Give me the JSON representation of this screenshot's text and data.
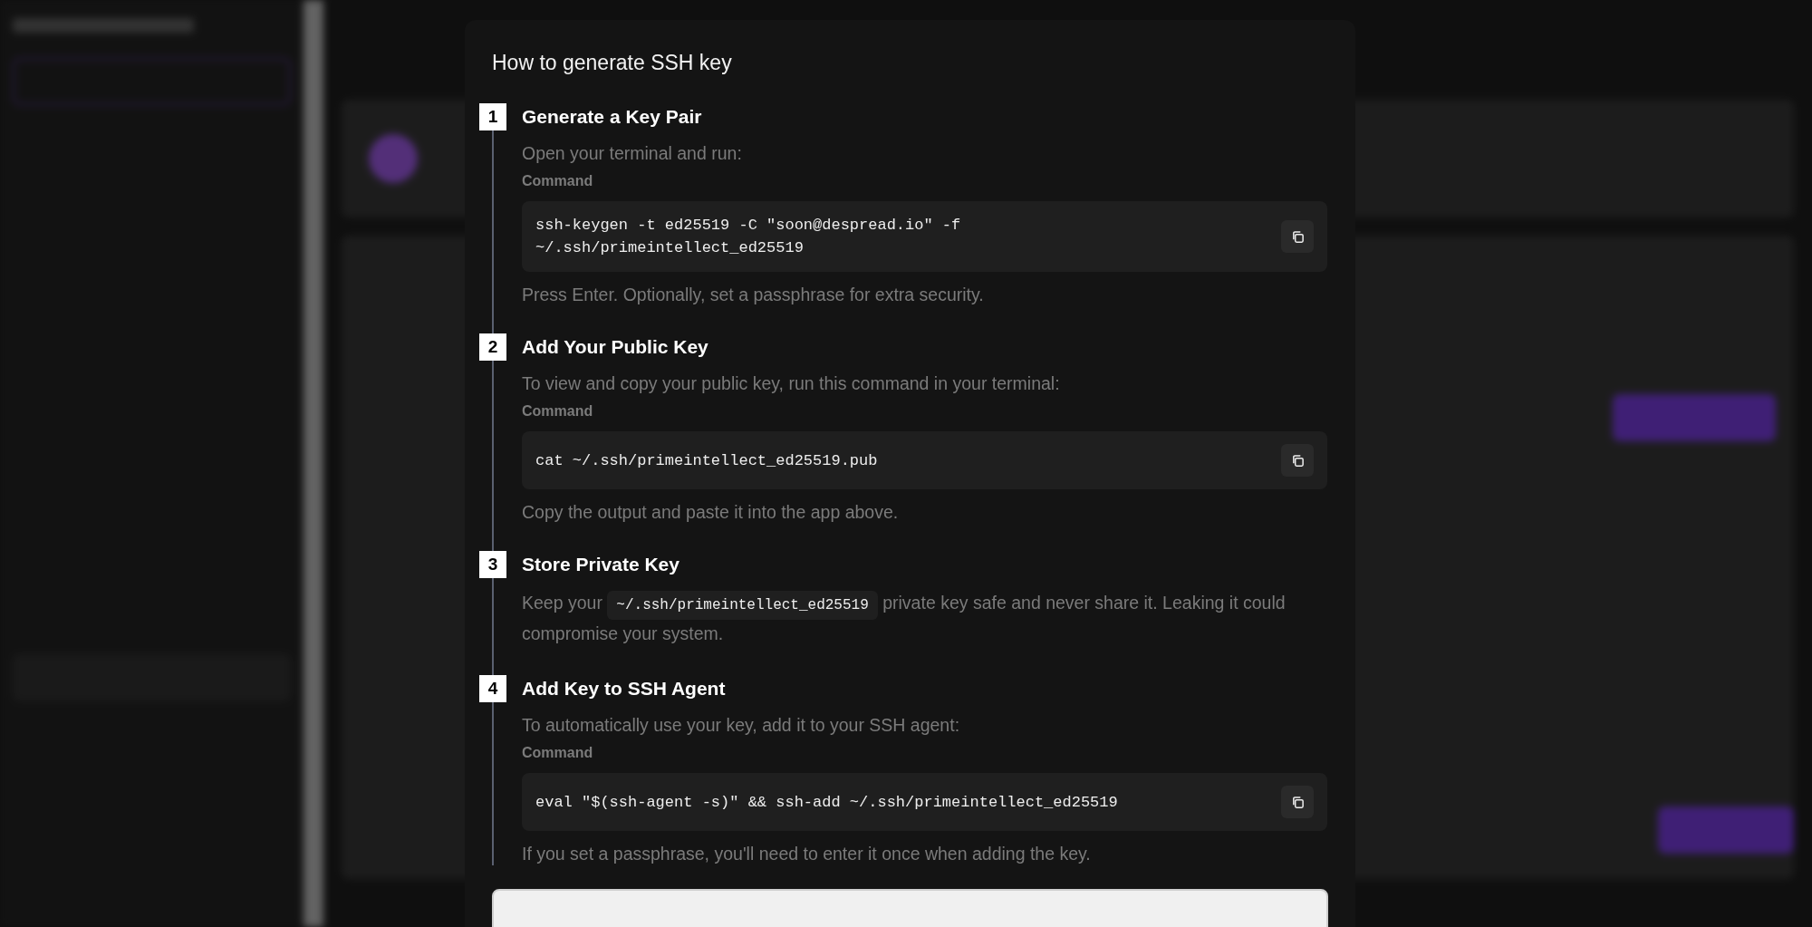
{
  "dialog": {
    "title": "How to generate SSH key",
    "steps": [
      {
        "number": "1",
        "heading": "Generate a Key Pair",
        "intro": "Open your terminal and run:",
        "command_label": "Command",
        "command": [
          "ssh-keygen -t ed25519 -C \"soon@despread.io\" -f",
          "~/.ssh/primeintellect_ed25519"
        ],
        "note": "Press Enter. Optionally, set a passphrase for extra security."
      },
      {
        "number": "2",
        "heading": "Add Your Public Key",
        "intro": "To view and copy your public key, run this command in your terminal:",
        "command_label": "Command",
        "command": [
          "cat ~/.ssh/primeintellect_ed25519.pub"
        ],
        "note": "Copy the output and paste it into the app above."
      },
      {
        "number": "3",
        "heading": "Store Private Key",
        "body": [
          {
            "kind": "text",
            "text": "Keep your"
          },
          {
            "kind": "code",
            "text": "~/.ssh/primeintellect_ed25519"
          },
          {
            "kind": "text",
            "text": "private key safe and never share it. Leaking it could compromise your system."
          }
        ]
      },
      {
        "number": "4",
        "heading": "Add Key to SSH Agent",
        "intro": "To automatically use your key, add it to your SSH agent:",
        "command_label": "Command",
        "command": [
          "eval \"$(ssh-agent -s)\" && ssh-add ~/.ssh/primeintellect_ed25519"
        ],
        "note": "If you set a passphrase, you'll need to enter it once when adding the key."
      }
    ]
  }
}
